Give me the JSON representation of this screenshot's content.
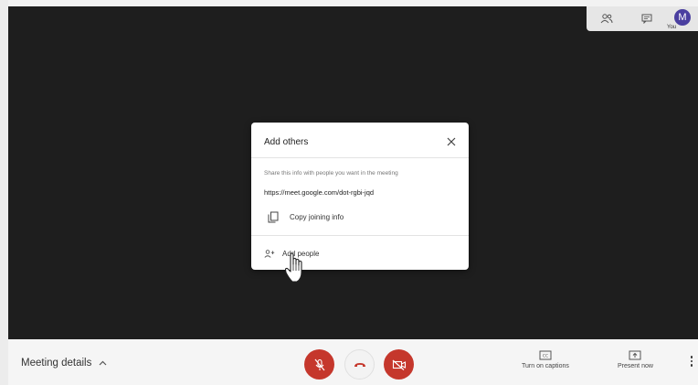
{
  "top_bar": {
    "avatar_initial": "M",
    "you_label": "You",
    "icons": [
      "people-icon",
      "chat-icon"
    ]
  },
  "dialog": {
    "title": "Add others",
    "share_text": "Share this info with people you want in the meeting",
    "url": "https://meet.google.com/dot-rgbi-jqd",
    "copy_label": "Copy joining info",
    "add_people_label": "Add people"
  },
  "bottom_bar": {
    "meeting_details": "Meeting details",
    "captions_label": "Turn on captions",
    "present_label": "Present now"
  },
  "colors": {
    "danger": "#c5372c",
    "avatar": "#4a3fa0",
    "stage": "#1e1e1e"
  }
}
